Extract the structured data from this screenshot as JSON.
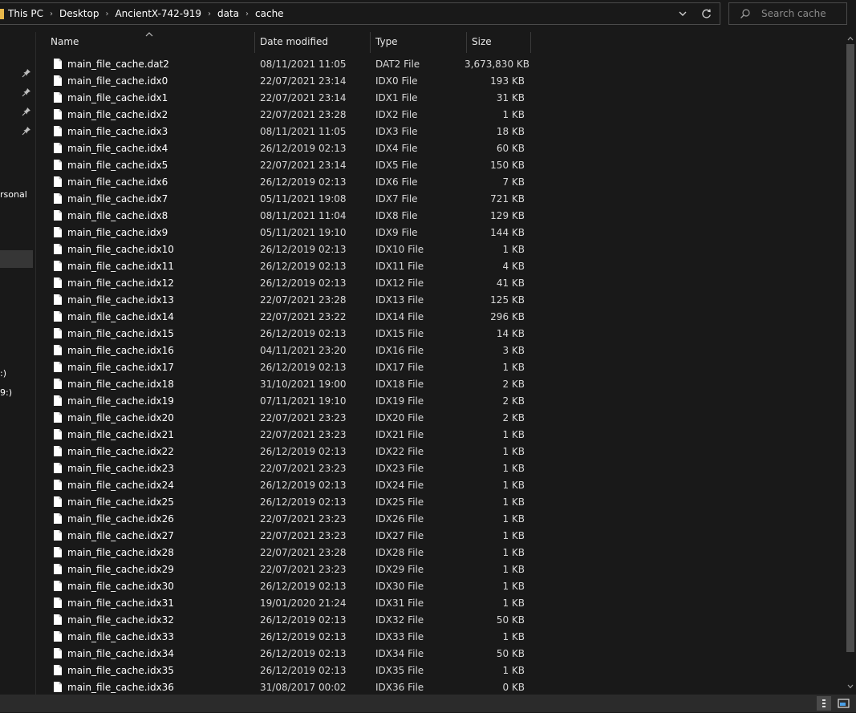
{
  "address": {
    "crumbs": [
      "This PC",
      "Desktop",
      "AncientX-742-919",
      "data",
      "cache"
    ],
    "separator": "›"
  },
  "search": {
    "placeholder": "Search cache"
  },
  "nav": {
    "text_personal": "rsonal",
    "text_drive_1": ":)",
    "text_drive_2": "9:)"
  },
  "columns": {
    "name": "Name",
    "date": "Date modified",
    "type": "Type",
    "size": "Size"
  },
  "files": [
    {
      "name": "main_file_cache.dat2",
      "date": "08/11/2021 11:05",
      "type": "DAT2 File",
      "size": "3,673,830 KB"
    },
    {
      "name": "main_file_cache.idx0",
      "date": "22/07/2021 23:14",
      "type": "IDX0 File",
      "size": "193 KB"
    },
    {
      "name": "main_file_cache.idx1",
      "date": "22/07/2021 23:14",
      "type": "IDX1 File",
      "size": "31 KB"
    },
    {
      "name": "main_file_cache.idx2",
      "date": "22/07/2021 23:28",
      "type": "IDX2 File",
      "size": "1 KB"
    },
    {
      "name": "main_file_cache.idx3",
      "date": "08/11/2021 11:05",
      "type": "IDX3 File",
      "size": "18 KB"
    },
    {
      "name": "main_file_cache.idx4",
      "date": "26/12/2019 02:13",
      "type": "IDX4 File",
      "size": "60 KB"
    },
    {
      "name": "main_file_cache.idx5",
      "date": "22/07/2021 23:14",
      "type": "IDX5 File",
      "size": "150 KB"
    },
    {
      "name": "main_file_cache.idx6",
      "date": "26/12/2019 02:13",
      "type": "IDX6 File",
      "size": "7 KB"
    },
    {
      "name": "main_file_cache.idx7",
      "date": "05/11/2021 19:08",
      "type": "IDX7 File",
      "size": "721 KB"
    },
    {
      "name": "main_file_cache.idx8",
      "date": "08/11/2021 11:04",
      "type": "IDX8 File",
      "size": "129 KB"
    },
    {
      "name": "main_file_cache.idx9",
      "date": "05/11/2021 19:10",
      "type": "IDX9 File",
      "size": "144 KB"
    },
    {
      "name": "main_file_cache.idx10",
      "date": "26/12/2019 02:13",
      "type": "IDX10 File",
      "size": "1 KB"
    },
    {
      "name": "main_file_cache.idx11",
      "date": "26/12/2019 02:13",
      "type": "IDX11 File",
      "size": "4 KB"
    },
    {
      "name": "main_file_cache.idx12",
      "date": "26/12/2019 02:13",
      "type": "IDX12 File",
      "size": "41 KB"
    },
    {
      "name": "main_file_cache.idx13",
      "date": "22/07/2021 23:28",
      "type": "IDX13 File",
      "size": "125 KB"
    },
    {
      "name": "main_file_cache.idx14",
      "date": "22/07/2021 23:22",
      "type": "IDX14 File",
      "size": "296 KB"
    },
    {
      "name": "main_file_cache.idx15",
      "date": "26/12/2019 02:13",
      "type": "IDX15 File",
      "size": "14 KB"
    },
    {
      "name": "main_file_cache.idx16",
      "date": "04/11/2021 23:20",
      "type": "IDX16 File",
      "size": "3 KB"
    },
    {
      "name": "main_file_cache.idx17",
      "date": "26/12/2019 02:13",
      "type": "IDX17 File",
      "size": "1 KB"
    },
    {
      "name": "main_file_cache.idx18",
      "date": "31/10/2021 19:00",
      "type": "IDX18 File",
      "size": "2 KB"
    },
    {
      "name": "main_file_cache.idx19",
      "date": "07/11/2021 19:10",
      "type": "IDX19 File",
      "size": "2 KB"
    },
    {
      "name": "main_file_cache.idx20",
      "date": "22/07/2021 23:23",
      "type": "IDX20 File",
      "size": "2 KB"
    },
    {
      "name": "main_file_cache.idx21",
      "date": "22/07/2021 23:23",
      "type": "IDX21 File",
      "size": "1 KB"
    },
    {
      "name": "main_file_cache.idx22",
      "date": "26/12/2019 02:13",
      "type": "IDX22 File",
      "size": "1 KB"
    },
    {
      "name": "main_file_cache.idx23",
      "date": "22/07/2021 23:23",
      "type": "IDX23 File",
      "size": "1 KB"
    },
    {
      "name": "main_file_cache.idx24",
      "date": "26/12/2019 02:13",
      "type": "IDX24 File",
      "size": "1 KB"
    },
    {
      "name": "main_file_cache.idx25",
      "date": "26/12/2019 02:13",
      "type": "IDX25 File",
      "size": "1 KB"
    },
    {
      "name": "main_file_cache.idx26",
      "date": "22/07/2021 23:23",
      "type": "IDX26 File",
      "size": "1 KB"
    },
    {
      "name": "main_file_cache.idx27",
      "date": "22/07/2021 23:23",
      "type": "IDX27 File",
      "size": "1 KB"
    },
    {
      "name": "main_file_cache.idx28",
      "date": "22/07/2021 23:28",
      "type": "IDX28 File",
      "size": "1 KB"
    },
    {
      "name": "main_file_cache.idx29",
      "date": "22/07/2021 23:23",
      "type": "IDX29 File",
      "size": "1 KB"
    },
    {
      "name": "main_file_cache.idx30",
      "date": "26/12/2019 02:13",
      "type": "IDX30 File",
      "size": "1 KB"
    },
    {
      "name": "main_file_cache.idx31",
      "date": "19/01/2020 21:24",
      "type": "IDX31 File",
      "size": "1 KB"
    },
    {
      "name": "main_file_cache.idx32",
      "date": "26/12/2019 02:13",
      "type": "IDX32 File",
      "size": "50 KB"
    },
    {
      "name": "main_file_cache.idx33",
      "date": "26/12/2019 02:13",
      "type": "IDX33 File",
      "size": "1 KB"
    },
    {
      "name": "main_file_cache.idx34",
      "date": "26/12/2019 02:13",
      "type": "IDX34 File",
      "size": "50 KB"
    },
    {
      "name": "main_file_cache.idx35",
      "date": "26/12/2019 02:13",
      "type": "IDX35 File",
      "size": "1 KB"
    },
    {
      "name": "main_file_cache.idx36",
      "date": "31/08/2017 00:02",
      "type": "IDX36 File",
      "size": "0 KB"
    }
  ],
  "icons": {
    "file": "file-icon",
    "pin": "pin-icon",
    "search": "search-icon",
    "dropdown": "chevron-down-icon",
    "refresh": "refresh-icon",
    "folder": "folder-icon",
    "details_view": "details-view-icon",
    "large_icons_view": "large-icons-view-icon"
  },
  "colors": {
    "background": "#191919",
    "header_text": "#e8e8e8",
    "selection": "#363636",
    "folder": "#e8b84a"
  }
}
